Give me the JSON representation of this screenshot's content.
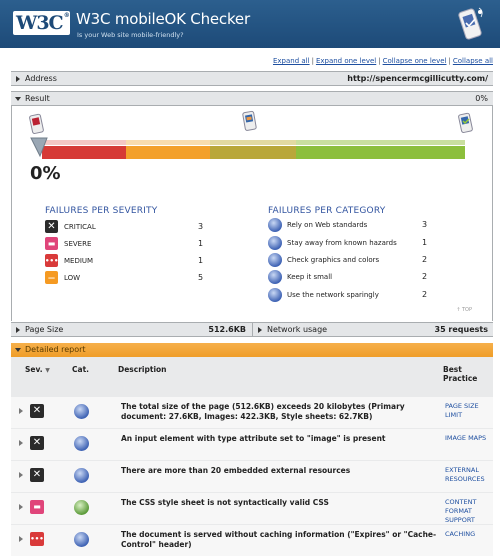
{
  "header": {
    "logo_text": "W3C",
    "logo_reg": "®",
    "title": "W3C mobileOK Checker",
    "subtitle": "Is your Web site mobile-friendly?"
  },
  "links": {
    "expand_all": "Expand all",
    "expand_one": "Expand one level",
    "collapse_one": "Collapse one level",
    "collapse_all": "Collapse all",
    "separator": "|"
  },
  "address": {
    "label": "Address",
    "value": "http://spencermcgillicutty.com/"
  },
  "result": {
    "label": "Result",
    "value": "0%",
    "big_score": "0%",
    "score_fraction": 0.0,
    "colors": {
      "red": "#d63a36",
      "orange": "#f3a02b",
      "olive": "#b9a73a",
      "green": "#8cbf3c"
    }
  },
  "severity": {
    "title": "FAILURES PER SEVERITY",
    "items": [
      {
        "label": "CRITICAL",
        "count": "3",
        "level": "critical"
      },
      {
        "label": "SEVERE",
        "count": "1",
        "level": "severe"
      },
      {
        "label": "MEDIUM",
        "count": "1",
        "level": "medium"
      },
      {
        "label": "LOW",
        "count": "5",
        "level": "low"
      }
    ]
  },
  "category": {
    "title": "FAILURES PER CATEGORY",
    "items": [
      {
        "label": "Rely on Web standards",
        "count": "3"
      },
      {
        "label": "Stay away from known hazards",
        "count": "1"
      },
      {
        "label": "Check graphics and colors",
        "count": "2"
      },
      {
        "label": "Keep it small",
        "count": "2"
      },
      {
        "label": "Use the network sparingly",
        "count": "2"
      }
    ]
  },
  "top_link": "↑ TOP",
  "page_size": {
    "label": "Page Size",
    "value": "512.6KB"
  },
  "network": {
    "label": "Network usage",
    "value": "35 requests"
  },
  "report": {
    "label": "Detailed report",
    "headers": {
      "sev": "Sev.",
      "cat": "Cat.",
      "desc": "Description",
      "bp": "Best Practice"
    },
    "rows": [
      {
        "sev": "critical",
        "desc": "The total size of the page (512.6KB) exceeds 20 kilobytes (Primary document: 27.6KB, Images: 422.3KB, Style sheets: 62.7KB)",
        "bp": "PAGE SIZE LIMIT"
      },
      {
        "sev": "critical",
        "desc": "An input element with type attribute set to \"image\" is present",
        "bp": "IMAGE MAPS"
      },
      {
        "sev": "critical",
        "desc": "There are more than 20 embedded external resources",
        "bp": "EXTERNAL RESOURCES"
      },
      {
        "sev": "severe",
        "desc": "The CSS style sheet is not syntactically valid CSS",
        "bp": "CONTENT FORMAT SUPPORT"
      },
      {
        "sev": "medium",
        "desc": "The document is served without caching information (\"Expires\" or \"Cache-Control\" header)",
        "bp": "CACHING"
      }
    ]
  }
}
